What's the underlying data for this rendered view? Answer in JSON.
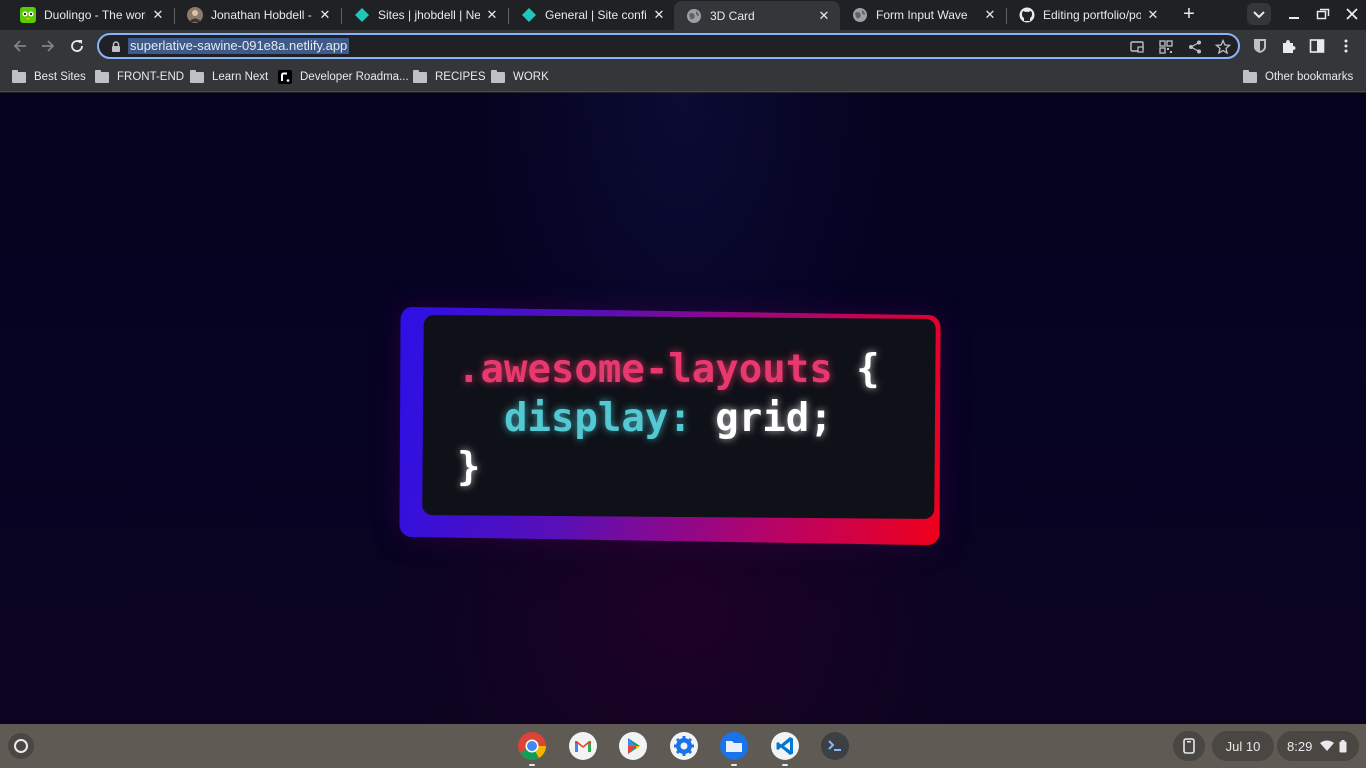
{
  "tabs": [
    {
      "title": "Duolingo - The world's",
      "icon": "duolingo-icon",
      "active": false
    },
    {
      "title": "Jonathan Hobdell - Pa",
      "icon": "avatar-icon",
      "active": false
    },
    {
      "title": "Sites | jhobdell | Netlif",
      "icon": "netlify-icon",
      "active": false
    },
    {
      "title": "General | Site configu",
      "icon": "netlify-icon",
      "active": false
    },
    {
      "title": "3D Card",
      "icon": "globe-icon",
      "active": true
    },
    {
      "title": "Form Input Wave",
      "icon": "globe-icon",
      "active": false
    },
    {
      "title": "Editing portfolio/post",
      "icon": "github-icon",
      "active": false
    }
  ],
  "omnibox": {
    "url": "superlative-sawine-091e8a.netlify.app"
  },
  "bookmarks": [
    {
      "label": "Best Sites",
      "icon": "folder-icon"
    },
    {
      "label": "FRONT-END",
      "icon": "folder-icon"
    },
    {
      "label": "Learn Next",
      "icon": "folder-icon"
    },
    {
      "label": "Developer Roadma...",
      "icon": "roadmap-icon"
    },
    {
      "label": "RECIPES",
      "icon": "folder-icon"
    },
    {
      "label": "WORK",
      "icon": "folder-icon"
    }
  ],
  "other_bookmarks": "Other bookmarks",
  "card": {
    "line1_selector": ".awesome-layouts",
    "line1_brace": " {",
    "line2_indent": "  ",
    "line2_property": "display:",
    "line2_value": " grid;",
    "line3_brace": "}"
  },
  "shelf": {
    "apps": [
      "chrome-icon",
      "gmail-icon",
      "play-store-icon",
      "settings-icon",
      "files-icon",
      "vscode-icon",
      "terminal-icon"
    ],
    "date": "Jul 10",
    "time": "8:29"
  },
  "colors": {
    "selector": "#e8386e",
    "property": "#52c9d3",
    "card_gradient_start": "#2b10e6",
    "card_gradient_end": "#f0001a",
    "omnibox_focus": "#8ab4f8"
  }
}
